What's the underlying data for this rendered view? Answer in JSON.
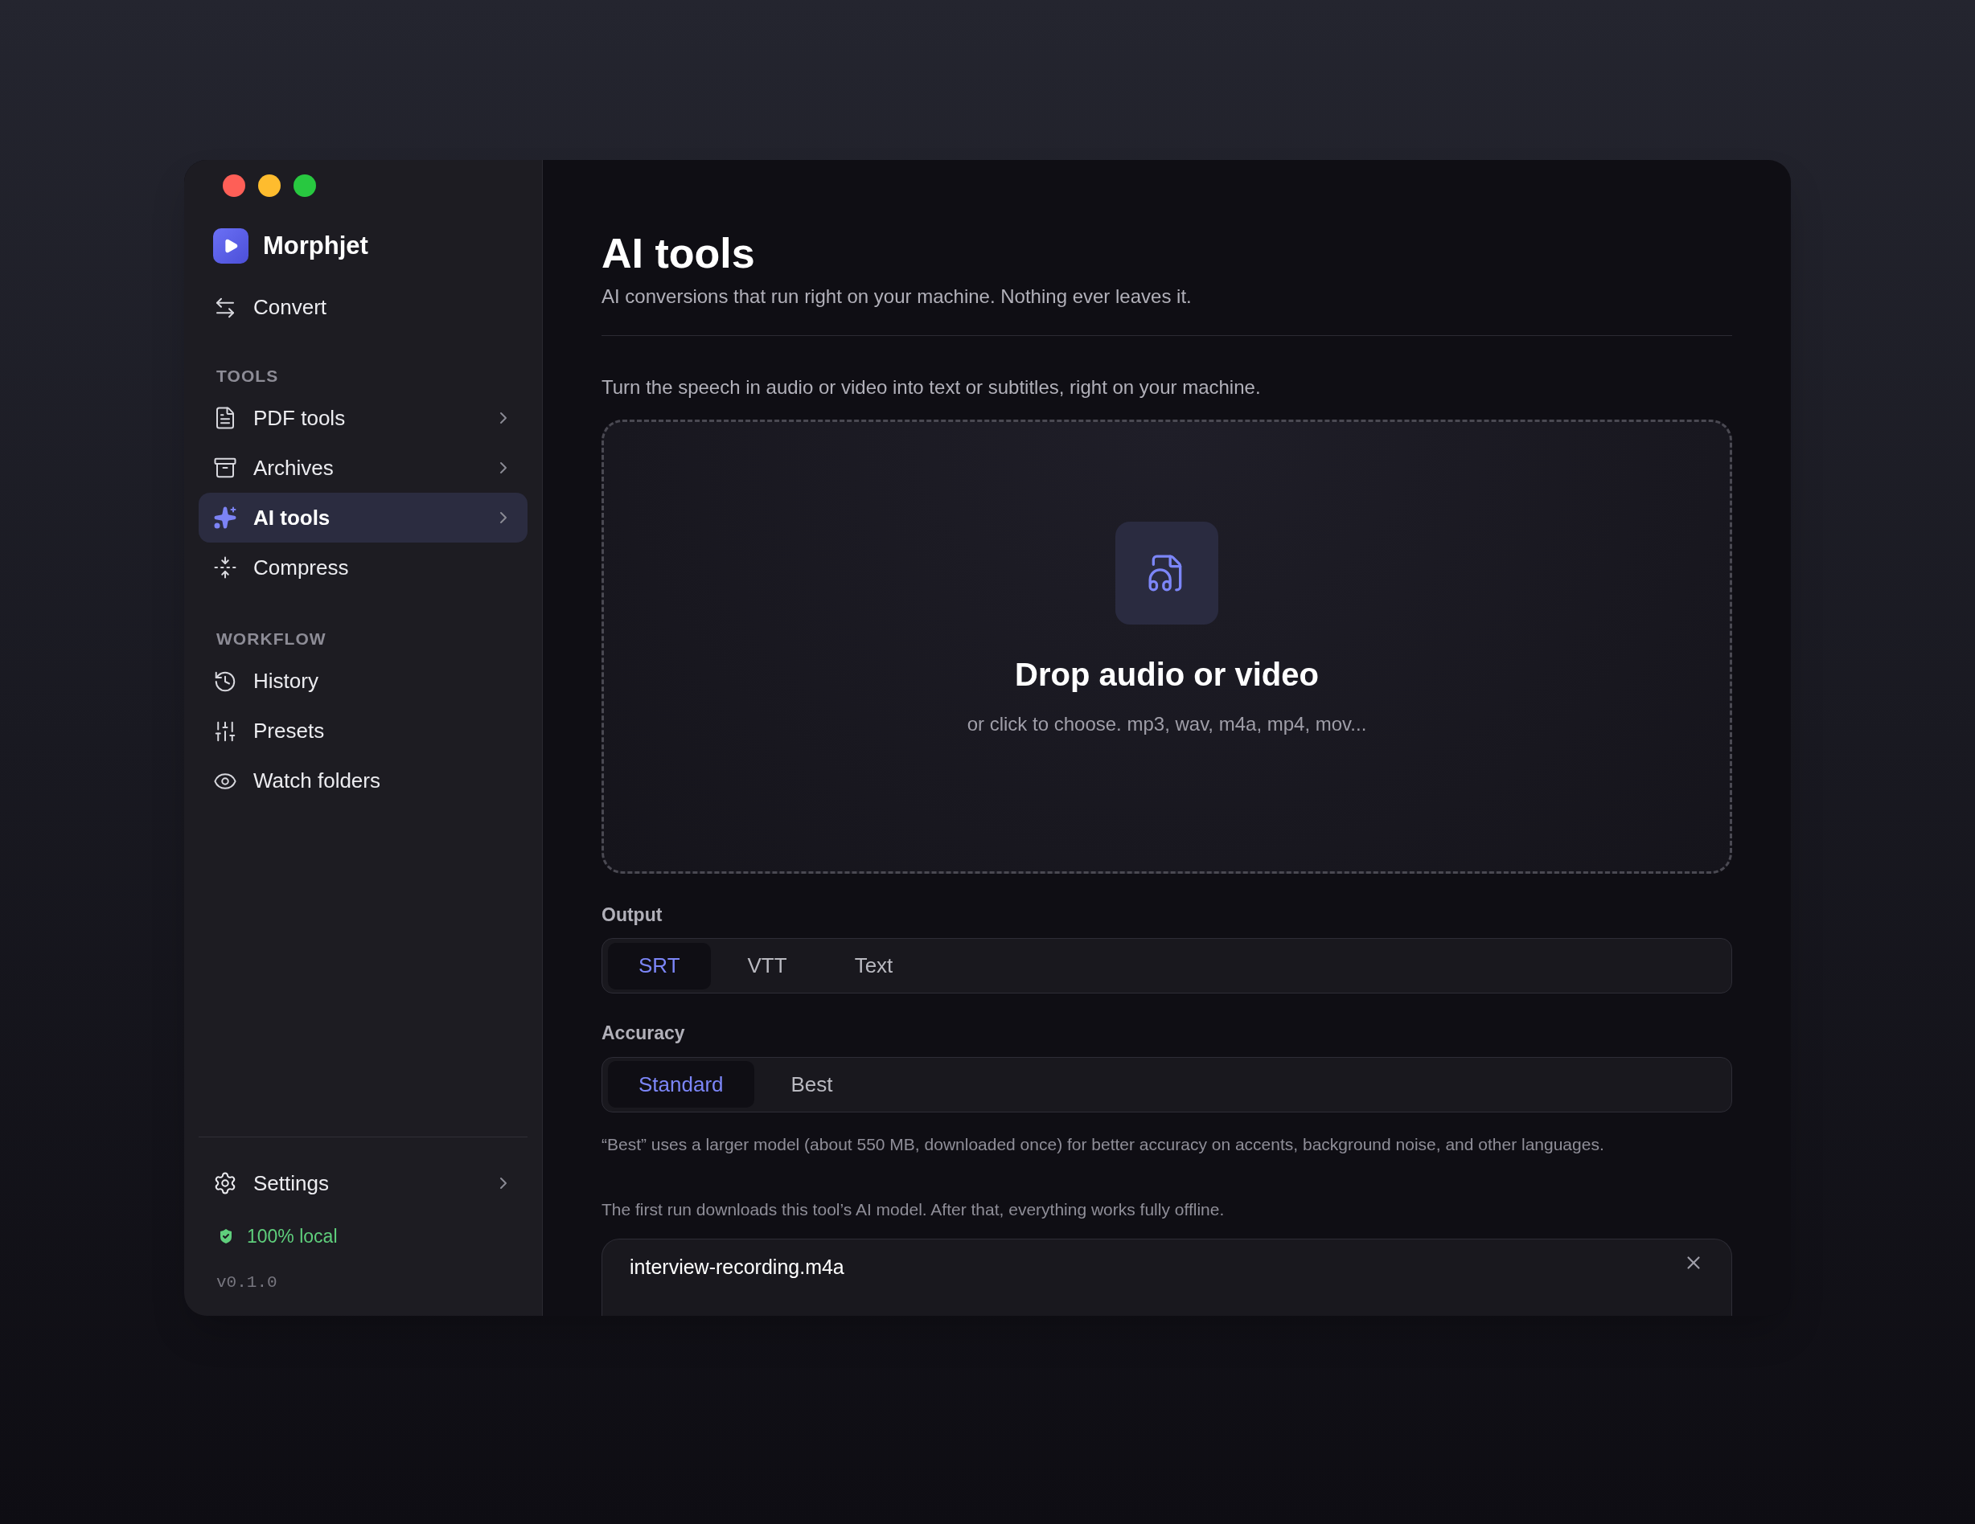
{
  "app": {
    "name": "Morphjet"
  },
  "sidebar": {
    "top_items": [
      {
        "label": "Convert",
        "selected": false,
        "expandable": false
      }
    ],
    "sections": [
      {
        "heading": "TOOLS",
        "items": [
          {
            "label": "PDF tools",
            "selected": false,
            "expandable": true
          },
          {
            "label": "Archives",
            "selected": false,
            "expandable": true
          },
          {
            "label": "AI tools",
            "selected": true,
            "expandable": true
          },
          {
            "label": "Compress",
            "selected": false,
            "expandable": false
          }
        ]
      },
      {
        "heading": "WORKFLOW",
        "items": [
          {
            "label": "History",
            "selected": false,
            "expandable": false
          },
          {
            "label": "Presets",
            "selected": false,
            "expandable": false
          },
          {
            "label": "Watch folders",
            "selected": false,
            "expandable": false
          }
        ]
      }
    ],
    "settings": {
      "label": "Settings",
      "expandable": true
    },
    "status": "100% local",
    "version": "v0.1.0"
  },
  "main": {
    "title": "AI tools",
    "subtitle": "AI conversions that run right on your machine. Nothing ever leaves it.",
    "description": "Turn the speech in audio or video into text or subtitles, right on your machine.",
    "dropzone": {
      "title": "Drop audio or video",
      "hint": "or click to choose. mp3, wav, m4a, mp4, mov..."
    },
    "output": {
      "label": "Output",
      "options": [
        {
          "label": "SRT",
          "selected": true
        },
        {
          "label": "VTT",
          "selected": false
        },
        {
          "label": "Text",
          "selected": false
        }
      ]
    },
    "accuracy": {
      "label": "Accuracy",
      "options": [
        {
          "label": "Standard",
          "selected": true
        },
        {
          "label": "Best",
          "selected": false
        }
      ]
    },
    "accuracy_note": "“Best” uses a larger model (about 550 MB, downloaded once) for better accuracy on accents, background noise, and other languages.",
    "model_note": "The first run downloads this tool’s AI model. After that, everything works fully offline.",
    "file": {
      "name": "interview-recording.m4a"
    }
  }
}
